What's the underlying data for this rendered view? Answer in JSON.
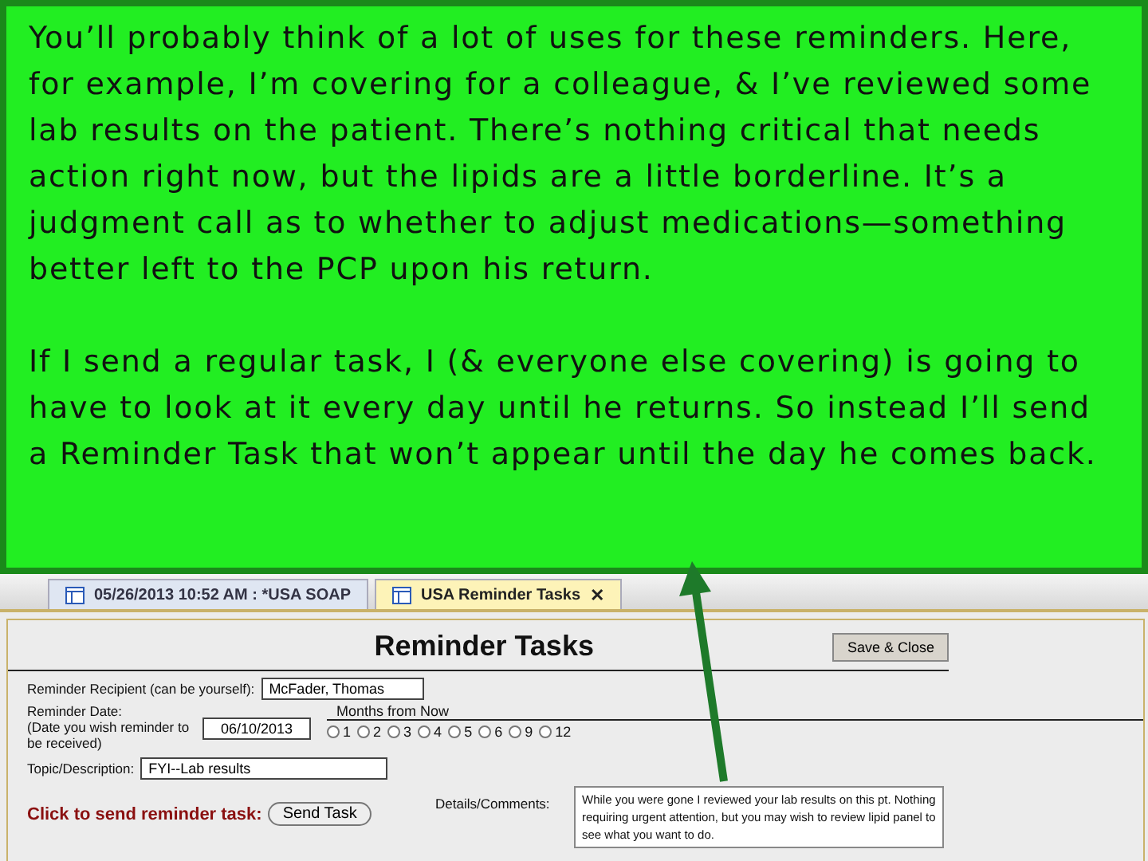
{
  "callout": {
    "paragraphs": [
      "You’ll probably think of a lot of uses for these reminders. Here, for example, I’m covering for a colleague, & I’ve reviewed some lab results on the patient. There’s nothing critical that needs action right now, but the lipids are a little borderline. It’s a judgment call as to whether to adjust medications—something better left to the PCP upon his return.",
      "If I send a regular task, I (& everyone else covering) is going to have to look at it every day until he returns. So instead I’ll send a Reminder Task that won’t appear until the day he comes back."
    ]
  },
  "tabs": [
    {
      "label": "05/26/2013 10:52 AM : *USA SOAP",
      "selected": false
    },
    {
      "label": "USA Reminder Tasks",
      "selected": true,
      "close": "✕"
    }
  ],
  "form": {
    "title": "Reminder Tasks",
    "save_button": "Save & Close",
    "recipient": {
      "label": "Reminder Recipient (can be yourself):",
      "value": "McFader, Thomas"
    },
    "date": {
      "label": "Reminder Date:",
      "hint": "(Date you wish reminder to be received)",
      "value": "06/10/2013"
    },
    "months": {
      "label": "Months from Now",
      "options": [
        {
          "label": "1",
          "selected": false
        },
        {
          "label": "2",
          "selected": false
        },
        {
          "label": "3",
          "selected": false
        },
        {
          "label": "4",
          "selected": false
        },
        {
          "label": "5",
          "selected": false
        },
        {
          "label": "6",
          "selected": false
        },
        {
          "label": "9",
          "selected": false
        },
        {
          "label": "12",
          "selected": false
        }
      ]
    },
    "topic": {
      "label": "Topic/Description:",
      "value": "FYI--Lab results"
    },
    "details": {
      "label": "Details/Comments:",
      "value": "While you were gone I reviewed your lab results on this pt.  Nothing requiring urgent attention, but you may wish to review lipid panel to see what you want to do."
    },
    "send": {
      "label": "Click to send reminder task:",
      "button": "Send Task"
    }
  }
}
